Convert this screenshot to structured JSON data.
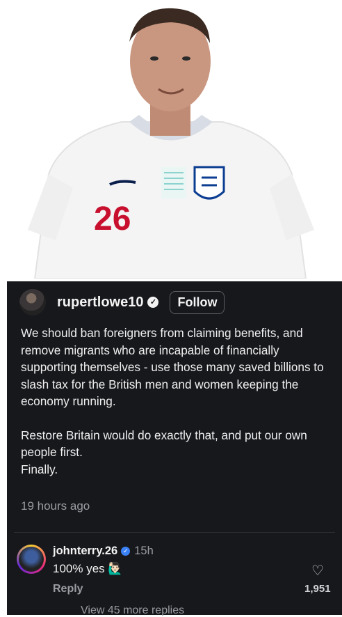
{
  "photo": {
    "shirt_number": "26"
  },
  "post": {
    "username": "rupertlowe10",
    "follow_label": "Follow",
    "paragraph1": "We should ban foreigners from claiming benefits, and remove migrants who are incapable of financially supporting themselves - use those many saved billions to slash tax for the British men and women keeping the economy running.",
    "paragraph2": "Restore Britain would do exactly that, and put our own people first.",
    "paragraph3": "Finally.",
    "timestamp": "19 hours ago"
  },
  "reply": {
    "username": "johnterry.26",
    "time": "15h",
    "text": "100% yes 🙋🏻‍♂️",
    "reply_label": "Reply",
    "likes": "1,951",
    "view_more": "View 45 more replies"
  },
  "colors": {
    "background": "#17181c",
    "muted": "#9a9ca2",
    "verified_blue": "#3b82f6"
  }
}
